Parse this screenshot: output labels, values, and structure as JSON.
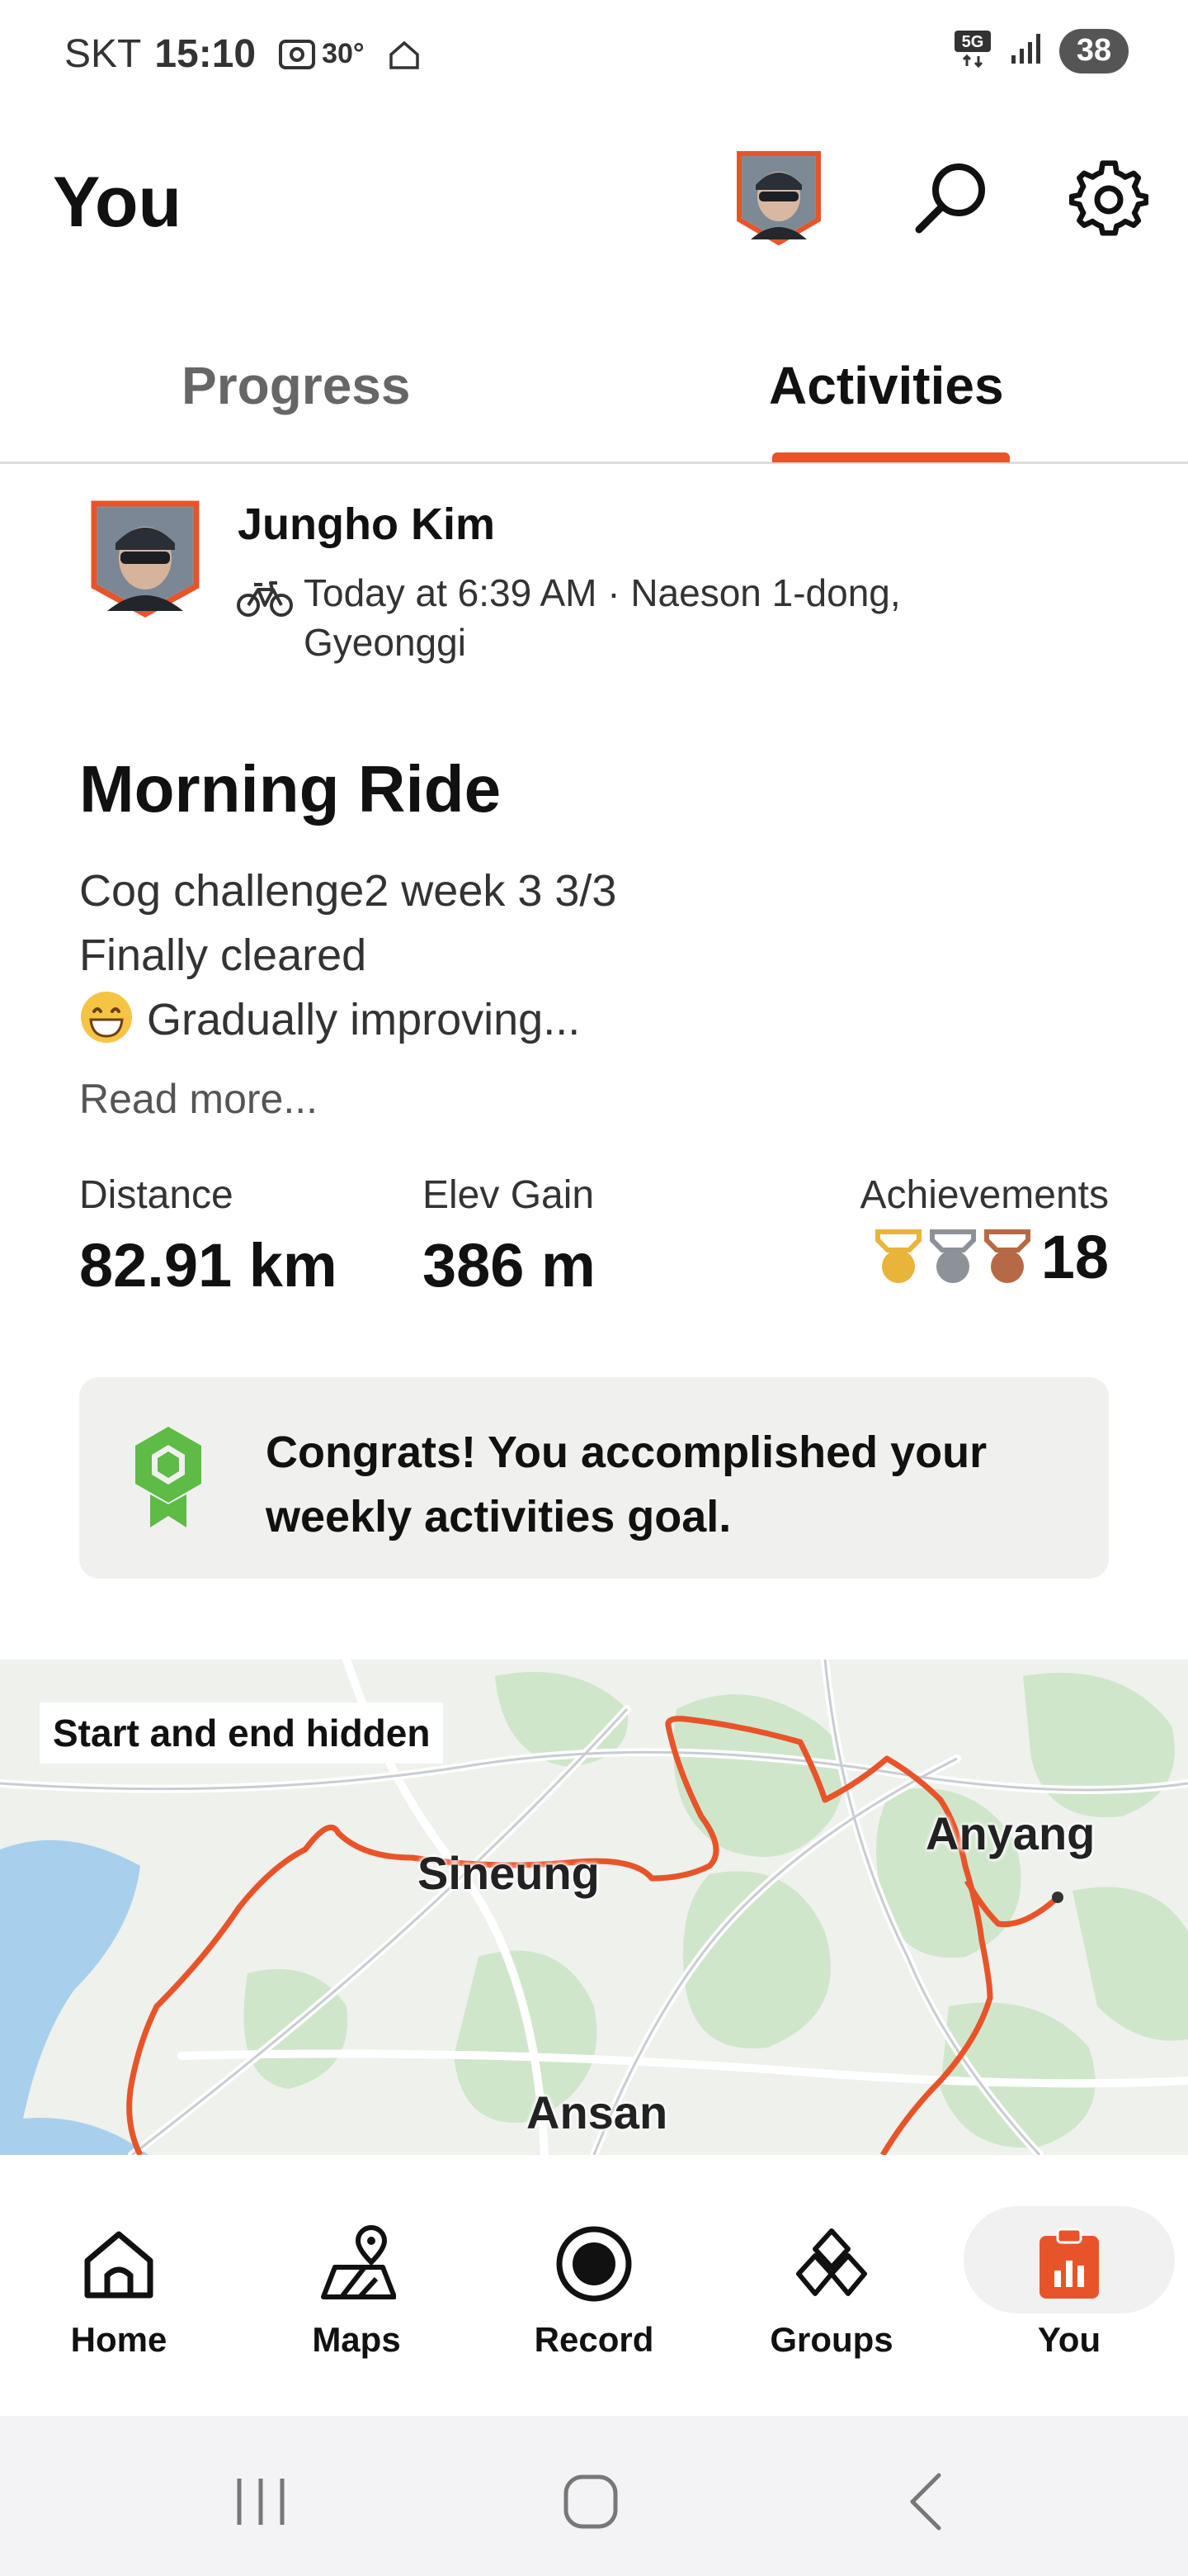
{
  "status_bar": {
    "carrier": "SKT",
    "time": "15:10",
    "temperature": "30°",
    "network": "5G",
    "battery": "38"
  },
  "header": {
    "title": "You"
  },
  "tabs": [
    {
      "label": "Progress",
      "selected": false
    },
    {
      "label": "Activities",
      "selected": true
    }
  ],
  "activity": {
    "athlete_name": "Jungho Kim",
    "meta_line1": "Today at 6:39 AM · Naeson 1-dong,",
    "meta_line2": "Gyeonggi",
    "title": "Morning Ride",
    "description": [
      "Cog challenge2 week 3 3/3",
      "Finally cleared",
      "Gradually improving..."
    ],
    "read_more": "Read more...",
    "stats": {
      "distance_label": "Distance",
      "distance_value": "82.91 km",
      "elev_label": "Elev Gain",
      "elev_value": "386 m",
      "achievements_label": "Achievements",
      "achievements_count": "18"
    },
    "goal_banner": "Congrats! You accomplished your weekly activities goal."
  },
  "map": {
    "badge": "Start and end hidden",
    "labels": [
      "Sineung",
      "Anyang",
      "Ansan"
    ]
  },
  "bottom_nav": [
    {
      "label": "Home",
      "icon": "home-icon"
    },
    {
      "label": "Maps",
      "icon": "maps-icon"
    },
    {
      "label": "Record",
      "icon": "record-icon"
    },
    {
      "label": "Groups",
      "icon": "groups-icon"
    },
    {
      "label": "You",
      "icon": "you-icon",
      "selected": true
    }
  ],
  "colors": {
    "accent": "#E8542A",
    "goal_green": "#5DBB46",
    "medal_gold": "#E8B43A",
    "medal_silver": "#8C9298",
    "medal_bronze": "#B56A45"
  }
}
